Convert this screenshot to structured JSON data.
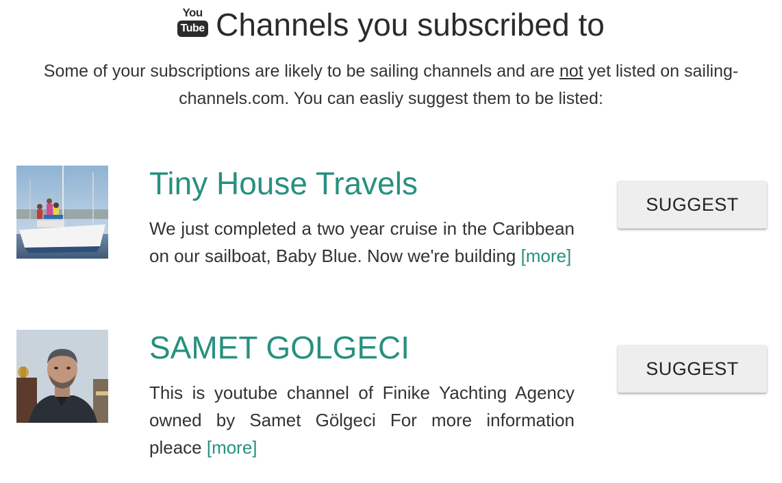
{
  "header": {
    "logo_you": "You",
    "logo_tube": "Tube",
    "title": "Channels you subscribed to"
  },
  "intro": {
    "before_not": "Some of your subscriptions are likely to be sailing channels and are ",
    "not_word": "not",
    "after_not": " yet listed on sailing-channels.com. You can easliy suggest them to be listed:"
  },
  "channels": [
    {
      "name": "Tiny House Travels",
      "description": "We just completed a two year cruise in the Caribbean on our sailboat, Baby Blue. Now we're building ",
      "more_label": "[more]",
      "button_label": "SUGGEST"
    },
    {
      "name": "SAMET GOLGECI",
      "description": "This is youtube channel of Finike Yachting Agency owned by Samet Gölgeci For more information pleace ",
      "more_label": "[more]",
      "button_label": "SUGGEST"
    }
  ],
  "colors": {
    "accent": "#27907f",
    "button_bg": "#eeeeee",
    "text": "#333333"
  }
}
